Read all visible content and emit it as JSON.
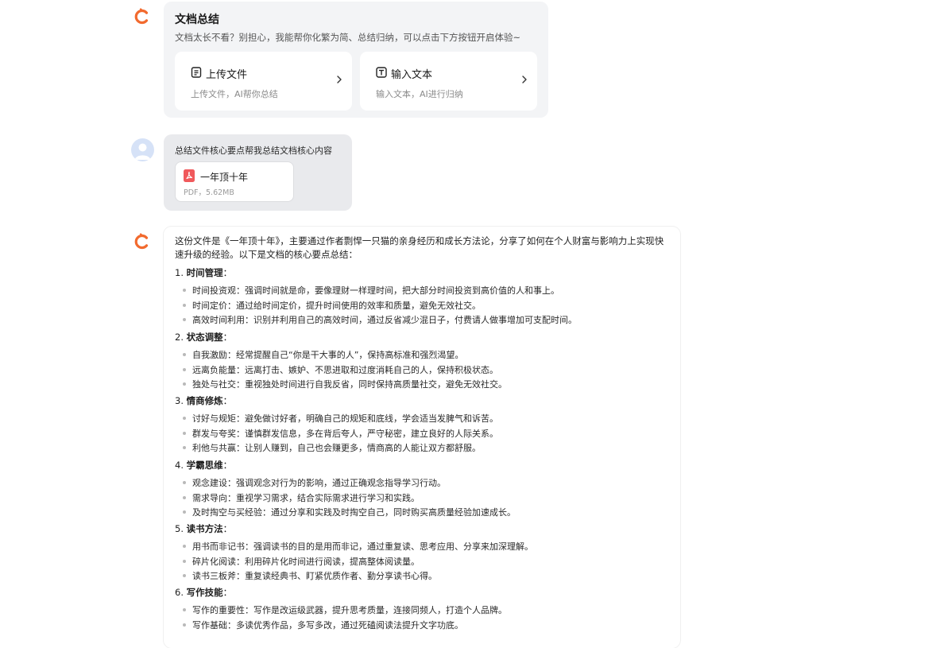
{
  "colors": {
    "brand": "#f26a2e",
    "card_bg": "#f3f4f6",
    "user_bg": "#e9eaed",
    "pdf_red": "#f0595c"
  },
  "welcome": {
    "title": "文档总结",
    "subtitle": "文档太长不看？别担心，我能帮你化繁为简、总结归纳，可以点击下方按钮开启体验~",
    "options": [
      {
        "icon": "document-icon",
        "title": "上传文件",
        "desc": "上传文件，AI帮你总结"
      },
      {
        "icon": "text-icon",
        "title": "输入文本",
        "desc": "输入文本，AI进行归纳"
      }
    ]
  },
  "user_message": {
    "text": "总结文件核心要点帮我总结文档核心内容",
    "file": {
      "name": "一年顶十年",
      "meta": "PDF，5.62MB"
    }
  },
  "answer": {
    "intro": "这份文件是《一年顶十年》，主要通过作者剽悍一只猫的亲身经历和成长方法论，分享了如何在个人财富与影响力上实现快速升级的经验。以下是文档的核心要点总结：",
    "sections": [
      {
        "num": "1.",
        "title": "时间管理",
        "colon": "：",
        "items": [
          "时间投资观：强调时间就是命，要像理财一样理时间，把大部分时间投资到高价值的人和事上。",
          "时间定价：通过给时间定价，提升时间使用的效率和质量，避免无效社交。",
          "高效时间利用：识别并利用自己的高效时间，通过反省减少混日子，付费请人做事增加可支配时间。"
        ]
      },
      {
        "num": "2.",
        "title": "状态调整",
        "colon": "：",
        "items": [
          "自我激励：经常提醒自己“你是干大事的人”，保持高标准和强烈渴望。",
          "远离负能量：远离打击、嫉妒、不思进取和过度消耗自己的人，保持积极状态。",
          "独处与社交：重视独处时间进行自我反省，同时保持高质量社交，避免无效社交。"
        ]
      },
      {
        "num": "3.",
        "title": "情商修炼",
        "colon": "：",
        "items": [
          "讨好与规矩：避免做讨好者，明确自己的规矩和底线，学会适当发脾气和诉苦。",
          "群发与夸奖：谨慎群发信息，多在背后夸人，严守秘密，建立良好的人际关系。",
          "利他与共赢：让别人赚到，自己也会赚更多，情商高的人能让双方都舒服。"
        ]
      },
      {
        "num": "4.",
        "title": "学霸思维",
        "colon": "：",
        "items": [
          "观念建设：强调观念对行为的影响，通过正确观念指导学习行动。",
          "需求导向：重视学习需求，结合实际需求进行学习和实践。",
          "及时掏空与买经验：通过分享和实践及时掏空自己，同时购买高质量经验加速成长。"
        ]
      },
      {
        "num": "5.",
        "title": "读书方法",
        "colon": "：",
        "items": [
          "用书而非记书：强调读书的目的是用而非记，通过重复读、思考应用、分享来加深理解。",
          "碎片化阅读：利用碎片化时间进行阅读，提高整体阅读量。",
          "读书三板斧：重复读经典书、盯紧优质作者、勤分享读书心得。"
        ]
      },
      {
        "num": "6.",
        "title": "写作技能",
        "colon": "：",
        "items": [
          "写作的重要性：写作是改运级武器，提升思考质量，连接同频人，打造个人品牌。",
          "写作基础：多读优秀作品，多写多改，通过死磕阅读法提升文字功底。"
        ]
      }
    ]
  }
}
